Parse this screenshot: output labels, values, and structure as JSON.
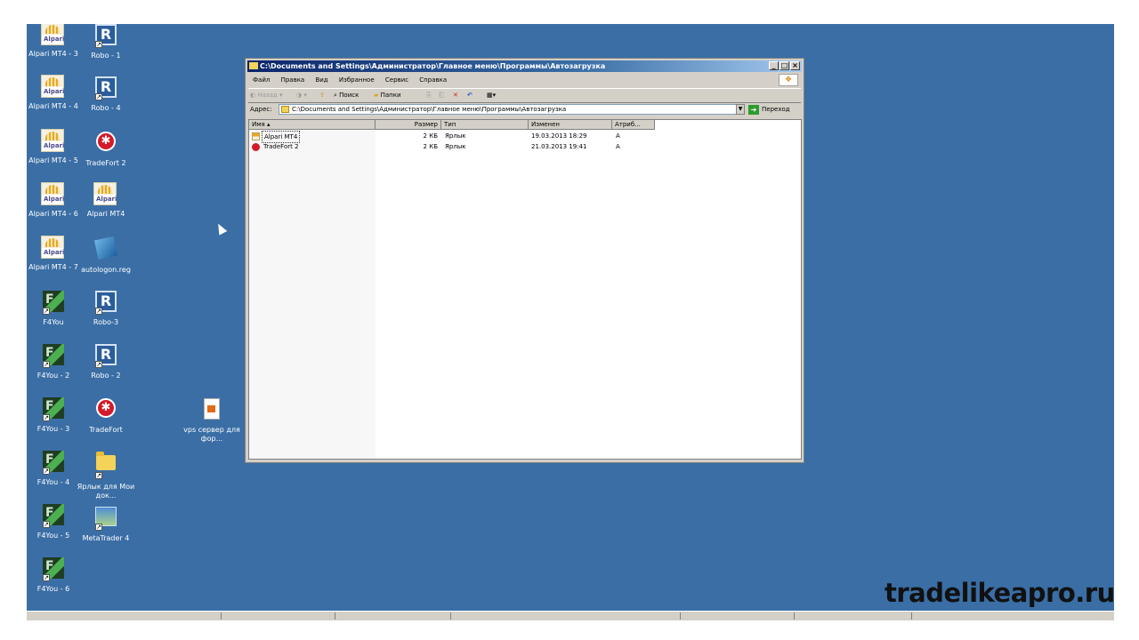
{
  "desktop": {
    "col1": [
      "Alpari MT4 - 3",
      "Alpari MT4 - 4",
      "Alpari MT4 - 5",
      "Alpari MT4 - 6",
      "Alpari MT4 - 7",
      "F4You",
      "F4You - 2",
      "F4You - 3",
      "F4You - 4",
      "F4You - 5",
      "F4You - 6"
    ],
    "col2": [
      "Robo - 1",
      "Robo - 4",
      "TradeFort 2",
      "Alpari MT4",
      "autologon.reg",
      "Robo-3",
      "Robo - 2",
      "TradeFort",
      "Ярлык для Мои док...",
      "MetaTrader 4"
    ],
    "col3": [
      "vps сервер для фор..."
    ],
    "alpari_text": "Alpari",
    "robo_text": "R",
    "f4_text": "F"
  },
  "window": {
    "title": "C:\\Documents and Settings\\Администратор\\Главное меню\\Программы\\Автозагрузка",
    "menu": [
      "Файл",
      "Правка",
      "Вид",
      "Избранное",
      "Сервис",
      "Справка"
    ],
    "toolbar": {
      "back": "Назад",
      "search": "Поиск",
      "folders": "Папки"
    },
    "address_label": "Адрес:",
    "address": "C:\\Documents and Settings\\Администратор\\Главное меню\\Программы\\Автозагрузка",
    "go": "Переход",
    "columns": [
      "Имя",
      "Размер",
      "Тип",
      "Изменен",
      "Атриб..."
    ],
    "files": [
      {
        "name": "Alpari MT4",
        "size": "2 КБ",
        "type": "Ярлык",
        "modified": "19.03.2013 18:29",
        "attr": "A"
      },
      {
        "name": "TradeFort 2",
        "size": "2 КБ",
        "type": "Ярлык",
        "modified": "21.03.2013 19:41",
        "attr": "A"
      }
    ]
  },
  "watermark": "tradelikeapro.ru"
}
